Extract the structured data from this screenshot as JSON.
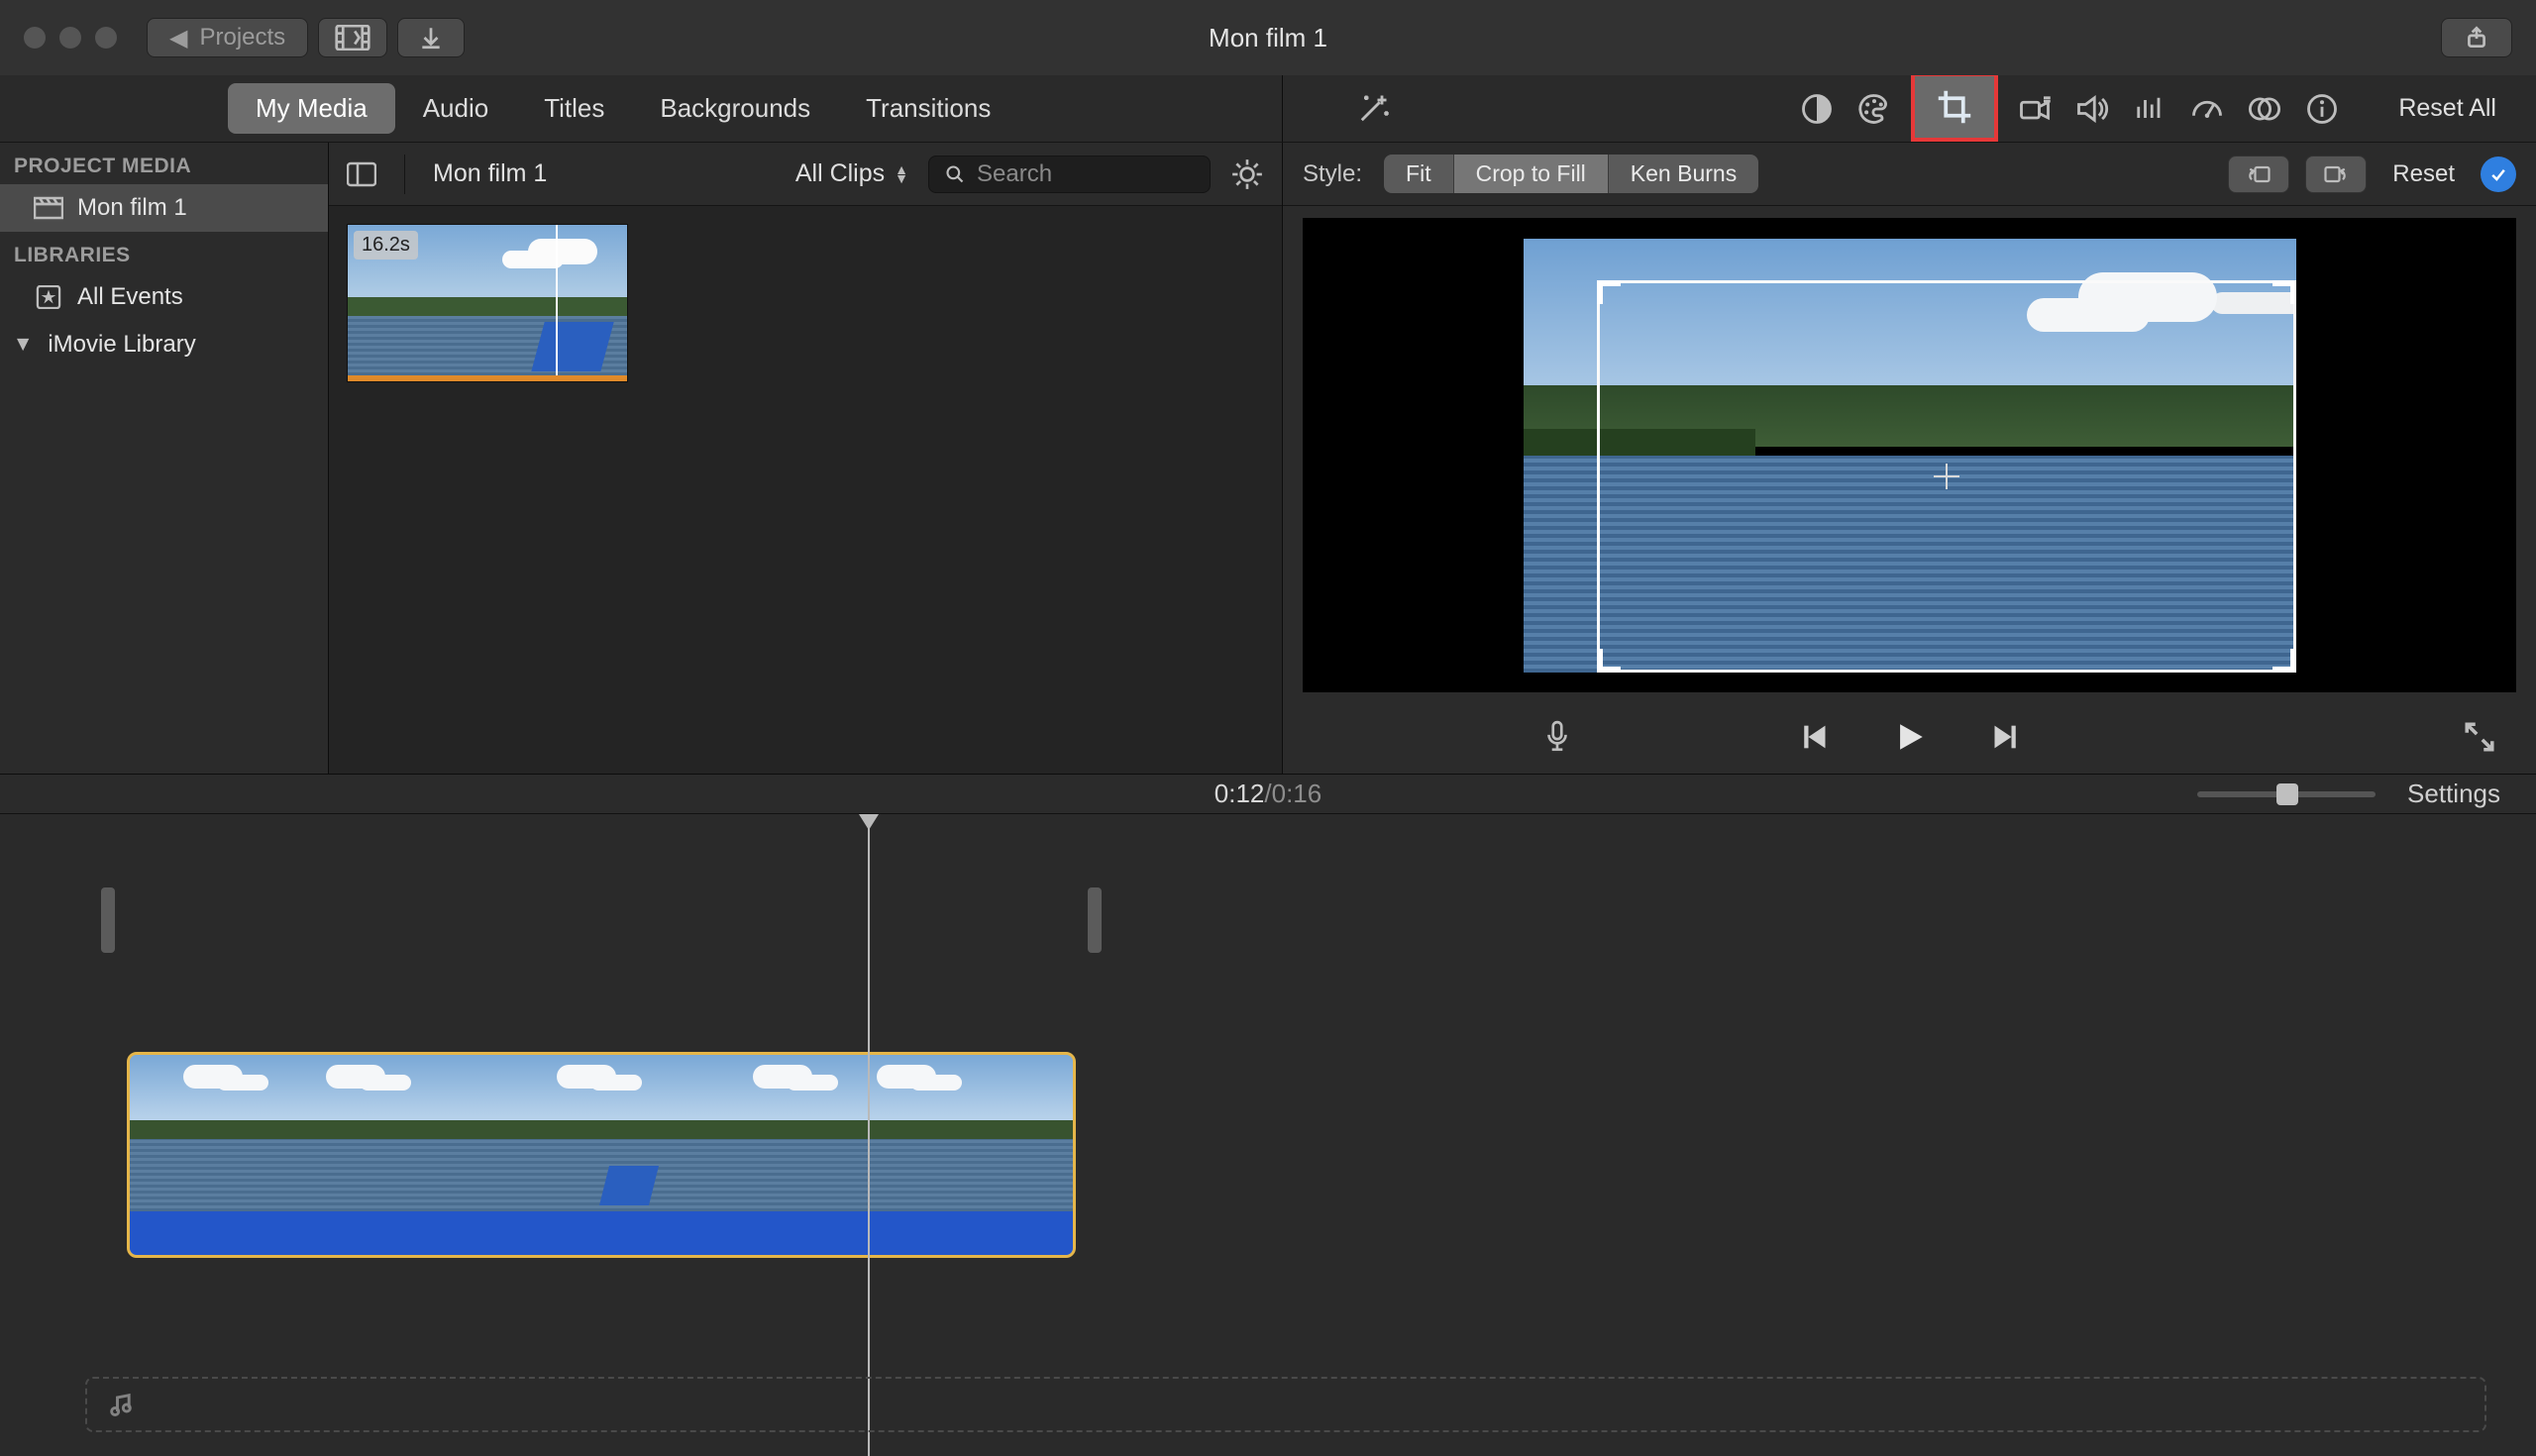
{
  "titlebar": {
    "projects_label": "Projects",
    "window_title": "Mon film 1"
  },
  "header": {
    "tabs": {
      "my_media": "My Media",
      "audio": "Audio",
      "titles": "Titles",
      "backgrounds": "Backgrounds",
      "transitions": "Transitions"
    },
    "active_tab": "my_media",
    "reset_all": "Reset All",
    "icons": {
      "enhance": "magic-wand-icon",
      "color_balance": "contrast-circle-icon",
      "color_correction": "palette-icon",
      "crop": "crop-icon",
      "stabilization": "camera-icon",
      "volume": "speaker-icon",
      "noise": "equalizer-icon",
      "speed": "speedometer-icon",
      "filter": "overlap-circles-icon",
      "info": "info-icon"
    }
  },
  "sidebar": {
    "project_media_header": "PROJECT MEDIA",
    "project_name": "Mon film 1",
    "libraries_header": "LIBRARIES",
    "all_events": "All Events",
    "imovie_library": "iMovie Library"
  },
  "media_browser": {
    "event_title": "Mon film 1",
    "filter_label": "All Clips",
    "search_placeholder": "Search",
    "clip_duration": "16.2s"
  },
  "viewer": {
    "style_label": "Style:",
    "segments": {
      "fit": "Fit",
      "crop_to_fill": "Crop to Fill",
      "ken_burns": "Ken Burns"
    },
    "active_segment": "crop_to_fill",
    "reset_label": "Reset"
  },
  "timebar": {
    "current": "0:12",
    "sep": " / ",
    "total": "0:16",
    "settings": "Settings"
  }
}
